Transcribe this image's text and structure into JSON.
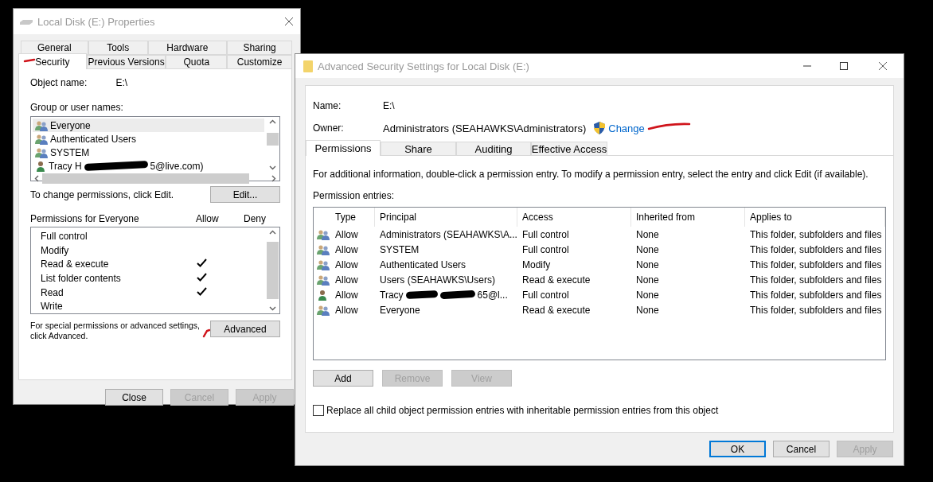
{
  "properties_window": {
    "title": "Local Disk  (E:) Properties",
    "tabs": [
      [
        {
          "label": "General",
          "selected": false
        },
        {
          "label": "Tools",
          "selected": false
        },
        {
          "label": "Hardware",
          "selected": false
        },
        {
          "label": "Sharing",
          "selected": false
        }
      ],
      [
        {
          "label": "Security",
          "selected": true
        },
        {
          "label": "Previous Versions",
          "selected": false
        },
        {
          "label": "Quota",
          "selected": false
        },
        {
          "label": "Customize",
          "selected": false
        }
      ]
    ],
    "object_name_label": "Object name:",
    "object_name": "E:\\",
    "group_label": "Group or user names:",
    "users": [
      {
        "kind": "group",
        "name": "Everyone",
        "selected": true
      },
      {
        "kind": "group",
        "name": "Authenticated Users",
        "selected": false
      },
      {
        "kind": "group",
        "name": "SYSTEM",
        "selected": false
      },
      {
        "kind": "user",
        "name": "Tracy H",
        "name_end": "5@live.com)",
        "redacted": true,
        "selected": false
      }
    ],
    "edit_hint": "To change permissions, click Edit.",
    "edit_button": "Edit...",
    "permissions_label": "Permissions for Everyone",
    "allow_label": "Allow",
    "deny_label": "Deny",
    "permissions": [
      {
        "name": "Full control",
        "allow": false,
        "deny": false
      },
      {
        "name": "Modify",
        "allow": false,
        "deny": false
      },
      {
        "name": "Read & execute",
        "allow": true,
        "deny": false
      },
      {
        "name": "List folder contents",
        "allow": true,
        "deny": false
      },
      {
        "name": "Read",
        "allow": true,
        "deny": false
      },
      {
        "name": "Write",
        "allow": false,
        "deny": false
      }
    ],
    "advanced_hint": [
      "For special permissions or advanced settings,",
      "click Advanced."
    ],
    "advanced_button": "Advanced",
    "buttons": [
      {
        "label": "Close",
        "disabled": false,
        "default": false
      },
      {
        "label": "Cancel",
        "disabled": true,
        "default": false
      },
      {
        "label": "Apply",
        "disabled": true,
        "default": false
      }
    ]
  },
  "advanced_window": {
    "title": "Advanced Security Settings for Local Disk  (E:)",
    "name_label": "Name:",
    "name": "E:\\",
    "owner_label": "Owner:",
    "owner": "Administrators (SEAHAWKS\\Administrators)",
    "change_link": "Change",
    "tabs": [
      {
        "label": "Permissions",
        "selected": true
      },
      {
        "label": "Share",
        "selected": false
      },
      {
        "label": "Auditing",
        "selected": false
      },
      {
        "label": "Effective Access",
        "selected": false
      }
    ],
    "info": "For additional information, double-click a permission entry. To modify a permission entry, select the entry and click Edit (if available).",
    "entries_label": "Permission entries:",
    "table": {
      "columns": [
        "Type",
        "Principal",
        "Access",
        "Inherited from",
        "Applies to"
      ],
      "rows": [
        {
          "kind": "group",
          "type": "Allow",
          "principal": "Administrators (SEAHAWKS\\A...",
          "access": "Full control",
          "inherited": "None",
          "applies": "This folder, subfolders and files"
        },
        {
          "kind": "group",
          "type": "Allow",
          "principal": "SYSTEM",
          "access": "Full control",
          "inherited": "None",
          "applies": "This folder, subfolders and files"
        },
        {
          "kind": "group",
          "type": "Allow",
          "principal": "Authenticated Users",
          "access": "Modify",
          "inherited": "None",
          "applies": "This folder, subfolders and files"
        },
        {
          "kind": "group",
          "type": "Allow",
          "principal": "Users (SEAHAWKS\\Users)",
          "access": "Read & execute",
          "inherited": "None",
          "applies": "This folder, subfolders and files"
        },
        {
          "kind": "user",
          "type": "Allow",
          "principal": "Tracy",
          "principal_end": "65@l...",
          "redacted": true,
          "access": "Full control",
          "inherited": "None",
          "applies": "This folder, subfolders and files"
        },
        {
          "kind": "group",
          "type": "Allow",
          "principal": "Everyone",
          "access": "Read & execute",
          "inherited": "None",
          "applies": "This folder, subfolders and files"
        }
      ]
    },
    "entry_buttons": [
      {
        "label": "Add",
        "disabled": false,
        "default": false
      },
      {
        "label": "Remove",
        "disabled": true,
        "default": false
      },
      {
        "label": "View",
        "disabled": true,
        "default": false
      }
    ],
    "replace_checkbox": {
      "label": "Replace all child object permission entries with inheritable permission entries from this object",
      "checked": false
    },
    "buttons": [
      {
        "label": "OK",
        "disabled": false,
        "default": true
      },
      {
        "label": "Cancel",
        "disabled": false,
        "default": false
      },
      {
        "label": "Apply",
        "disabled": true,
        "default": false
      }
    ]
  }
}
